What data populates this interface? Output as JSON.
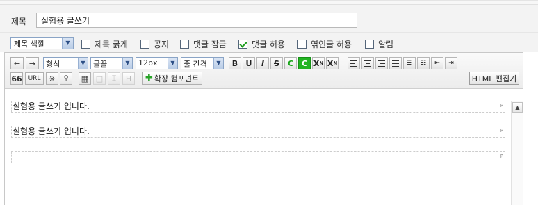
{
  "form": {
    "title_label": "제목",
    "title_value": "실험용 글쓰기"
  },
  "options": {
    "title_color": "제목 색깔",
    "checkboxes": [
      {
        "label": "제목 굵게",
        "checked": false
      },
      {
        "label": "공지",
        "checked": false
      },
      {
        "label": "댓글 잠금",
        "checked": false
      },
      {
        "label": "댓글 허용",
        "checked": true
      },
      {
        "label": "엮인글 허용",
        "checked": false
      },
      {
        "label": "알림",
        "checked": false
      }
    ]
  },
  "toolbar": {
    "undo_icon": "←",
    "redo_icon": "→",
    "style_select": "형식",
    "font_select": "글꼴",
    "size_select": "12px",
    "line_height_select": "줄 간격",
    "bold": "B",
    "underline": "U",
    "italic": "I",
    "strike": "S",
    "font_color": "C",
    "bg_color": "C",
    "superscript": "X",
    "subscript": "X",
    "quote": "66",
    "url": "URL",
    "special_char": "※",
    "find": "🔍",
    "extension": "확장 컴포넌트",
    "html_editor": "HTML 편집기",
    "accent_green": "#22b422"
  },
  "content": {
    "paragraphs": [
      "실험용 글쓰기 입니다.",
      "실험용 글쓰기 입니다.",
      ""
    ],
    "p_tag": "P"
  }
}
